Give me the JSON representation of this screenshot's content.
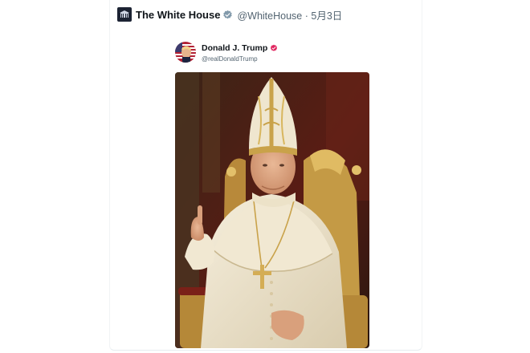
{
  "post": {
    "author_name": "The White House",
    "author_handle": "@WhiteHouse",
    "separator": "·",
    "date": "5月3日",
    "verified_badge_icon": "gray-verified-badge-icon",
    "avatar_icon": "white-house-logo-icon"
  },
  "quoted_post": {
    "author_name": "Donald J. Trump",
    "author_handle": "@realDonaldTrump",
    "verified_badge_icon": "pink-verified-badge-icon",
    "avatar_icon": "flag-profile-photo-icon"
  },
  "image": {
    "subject_icon": "figure-in-papal-vestments-image"
  },
  "colors": {
    "name_text": "#0f1419",
    "handle_text": "#536471",
    "verified_gray": "#829aab",
    "verified_pink": "#e0245e",
    "background_red": "#5a1c14",
    "vestment_cream": "#efe6cf",
    "gold": "#c9a24a"
  }
}
